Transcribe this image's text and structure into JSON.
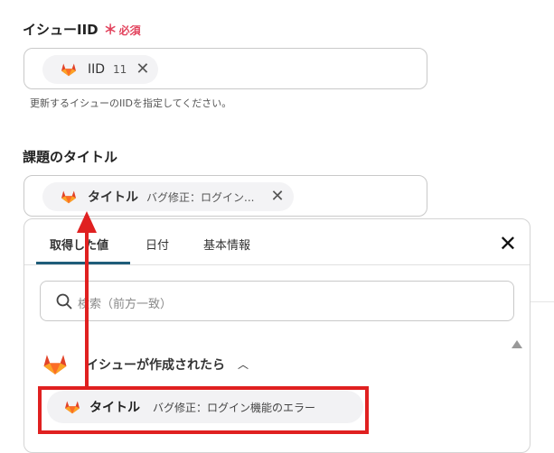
{
  "field_iid": {
    "label": "イシューIID",
    "required_mark": "＊",
    "required_text": "必須",
    "chip": {
      "name": "IID",
      "value": "11",
      "remove": "✕",
      "icon": "gitlab-fox-icon"
    },
    "help": "更新するイシューのIIDを指定してください。"
  },
  "field_title": {
    "label": "課題のタイトル",
    "chip": {
      "name": "タイトル",
      "value": "バグ修正：ログイン...",
      "remove": "✕",
      "icon": "gitlab-fox-icon"
    }
  },
  "picker": {
    "tabs": [
      "取得した値",
      "日付",
      "基本情報"
    ],
    "active_tab": "取得した値",
    "close": "✕",
    "search_placeholder": "検索（前方一致）",
    "group": {
      "title": "イシューが作成されたら",
      "caret": "︿",
      "icon": "gitlab-fox-icon"
    },
    "item": {
      "name": "タイトル",
      "value": "バグ修正：ログイン機能のエラー"
    }
  },
  "colors": {
    "gitlab_orange": "#e24329",
    "required": "#e2435d",
    "tab_accent": "#1f5d7a",
    "annotation_red": "#e02020"
  }
}
